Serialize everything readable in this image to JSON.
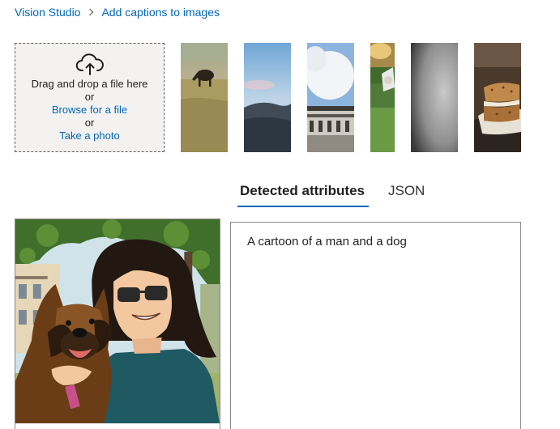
{
  "breadcrumb": {
    "root": "Vision Studio",
    "current": "Add captions to images"
  },
  "upload": {
    "icon": "cloud-upload-icon",
    "drag_text": "Drag and drop a file here",
    "or_1": "or",
    "browse_label": "Browse for a file",
    "or_2": "or",
    "photo_label": "Take a photo"
  },
  "samples": [
    {
      "subject": "cow grazing in field"
    },
    {
      "subject": "sky over rocky hill"
    },
    {
      "subject": "clouds above building"
    },
    {
      "subject": "sports player"
    },
    {
      "subject": "grey gradient"
    },
    {
      "subject": "sandwich on plate"
    }
  ],
  "tabs": {
    "detected": "Detected attributes",
    "json": "JSON"
  },
  "result": {
    "caption": "A cartoon of a man and a dog"
  },
  "colors": {
    "accent": "#0067b8",
    "dropzone_bg": "#f3f2f1"
  }
}
